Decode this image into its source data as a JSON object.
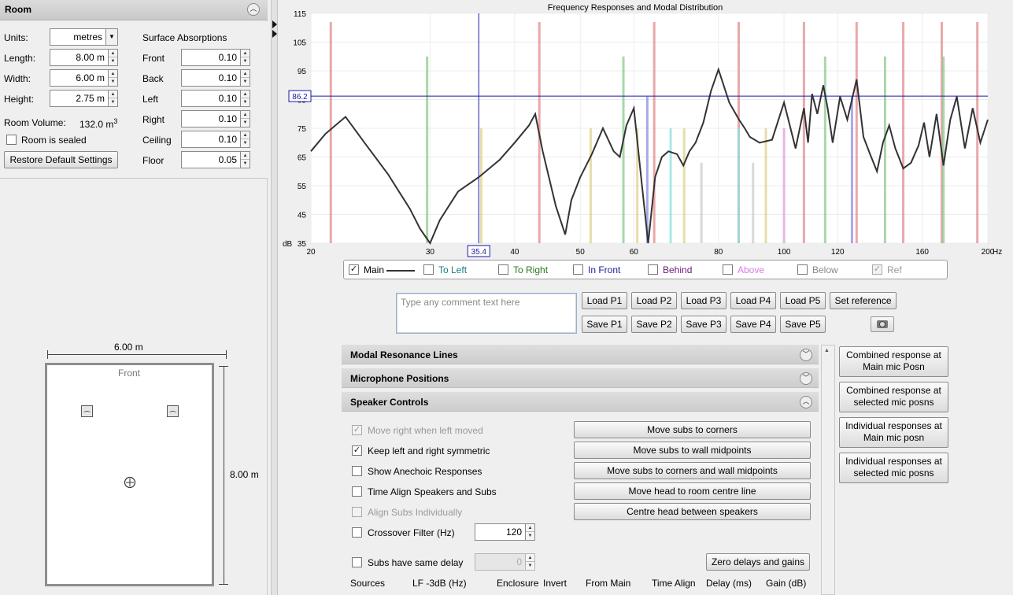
{
  "room": {
    "title": "Room",
    "units_label": "Units:",
    "units_value": "metres",
    "length_label": "Length:",
    "length_value": "8.00 m",
    "width_label": "Width:",
    "width_value": "6.00 m",
    "height_label": "Height:",
    "height_value": "2.75 m",
    "volume_label": "Room Volume:",
    "volume_value": "132.0 m",
    "volume_sup": "3",
    "sealed_label": "Room is sealed",
    "restore_label": "Restore Default Settings",
    "surface_title": "Surface Absorptions",
    "surfaces": [
      {
        "label": "Front",
        "value": "0.10"
      },
      {
        "label": "Back",
        "value": "0.10"
      },
      {
        "label": "Left",
        "value": "0.10"
      },
      {
        "label": "Right",
        "value": "0.10"
      },
      {
        "label": "Ceiling",
        "value": "0.10"
      },
      {
        "label": "Floor",
        "value": "0.05"
      }
    ]
  },
  "diagram": {
    "width_label": "6.00 m",
    "length_label": "8.00 m",
    "front_label": "Front"
  },
  "chart_data": {
    "type": "line",
    "title": "Frequency Responses and Modal Distribution",
    "xscale": "log",
    "xlim": [
      20,
      200
    ],
    "ylim": [
      35,
      115
    ],
    "xunit": "Hz",
    "yunit": "dB",
    "xticks": [
      20,
      30,
      40,
      50,
      60,
      80,
      100,
      120,
      160,
      200
    ],
    "yticks": [
      35,
      45,
      55,
      65,
      75,
      85,
      95,
      105,
      115
    ],
    "cursor": {
      "x": "35.4",
      "y": "86.2"
    },
    "series": [
      {
        "name": "Main",
        "color": "#333333",
        "x": [
          20,
          21,
          22.5,
          24,
          26,
          28,
          29,
          30,
          31,
          33,
          35.4,
          38,
          40,
          42,
          42.9,
          44,
          46,
          47.5,
          48.5,
          50,
          52,
          54,
          56,
          57.2,
          58.5,
          60,
          61.5,
          63,
          64.5,
          66,
          67.5,
          69.5,
          71,
          72.5,
          74,
          76,
          78,
          80,
          83,
          85.8,
          87.5,
          89,
          92,
          96,
          100,
          104,
          107,
          108.5,
          110,
          112,
          114.3,
          116,
          118,
          121,
          124,
          128,
          131,
          134,
          137.2,
          140,
          143,
          146,
          150,
          154,
          158,
          161,
          164,
          168,
          172,
          176,
          180,
          185,
          190,
          195,
          200
        ],
        "y": [
          67,
          73,
          79,
          70,
          59,
          47,
          40,
          30,
          43,
          53,
          58,
          64,
          70,
          76,
          80,
          67,
          48,
          38,
          50,
          58,
          66,
          75,
          67,
          65,
          76,
          82,
          58,
          35,
          58,
          65,
          67,
          66,
          62,
          67,
          70,
          77,
          88,
          95.5,
          84,
          78,
          75,
          72,
          70,
          71,
          84,
          68,
          82,
          70,
          87,
          80,
          90,
          82,
          70,
          86,
          78,
          92,
          72,
          66,
          60,
          70,
          76,
          68,
          61,
          63,
          69,
          77,
          65,
          80,
          62,
          78,
          86,
          68,
          82,
          70,
          78
        ]
      }
    ]
  },
  "legend": [
    {
      "label": "Main",
      "checked": true,
      "color": "#000000"
    },
    {
      "label": "To Left",
      "checked": false,
      "color": "#1a8080"
    },
    {
      "label": "To Right",
      "checked": false,
      "color": "#2a7a1f"
    },
    {
      "label": "In Front",
      "checked": false,
      "color": "#1d1d9a"
    },
    {
      "label": "Behind",
      "checked": false,
      "color": "#6b1a7a"
    },
    {
      "label": "Above",
      "checked": false,
      "color": "#d680e0"
    },
    {
      "label": "Below",
      "checked": false,
      "color": "#8a8a8a"
    },
    {
      "label": "Ref",
      "checked": true,
      "color": "#9a9a9a"
    }
  ],
  "comment_placeholder": "Type any comment text here",
  "load_buttons": [
    "Load P1",
    "Load P2",
    "Load P3",
    "Load P4",
    "Load P5"
  ],
  "save_buttons": [
    "Save P1",
    "Save P2",
    "Save P3",
    "Save P4",
    "Save P5"
  ],
  "set_reference": "Set reference",
  "sections": {
    "modal": "Modal Resonance Lines",
    "mic": "Microphone Positions",
    "speaker": "Speaker Controls"
  },
  "speaker": {
    "options": [
      {
        "label": "Move right when left moved",
        "checked": true,
        "disabled": true
      },
      {
        "label": "Keep left and right symmetric",
        "checked": true,
        "disabled": false
      },
      {
        "label": "Show Anechoic Responses",
        "checked": false,
        "disabled": false
      },
      {
        "label": "Time Align Speakers and Subs",
        "checked": false,
        "disabled": false
      },
      {
        "label": "Align Subs Individually",
        "checked": false,
        "disabled": true
      },
      {
        "label": "Crossover Filter (Hz)",
        "checked": false,
        "disabled": false
      },
      {
        "label": "Subs have same delay",
        "checked": false,
        "disabled": false
      }
    ],
    "crossover_value": "120",
    "delay_value": "0",
    "actions": [
      "Move subs to corners",
      "Move subs to wall midpoints",
      "Move subs to corners and wall midpoints",
      "Move head to room centre line",
      "Centre head between speakers"
    ],
    "zero_button": "Zero delays and gains",
    "columns": [
      "Sources",
      "LF -3dB (Hz)",
      "Enclosure",
      "Invert",
      "From Main",
      "Time Align",
      "Delay (ms)",
      "Gain (dB)"
    ]
  },
  "right_buttons": [
    "Combined response at Main mic Posn",
    "Combined response at selected mic posns",
    "Individual responses at Main mic posn",
    "Individual responses at selected mic posns"
  ]
}
